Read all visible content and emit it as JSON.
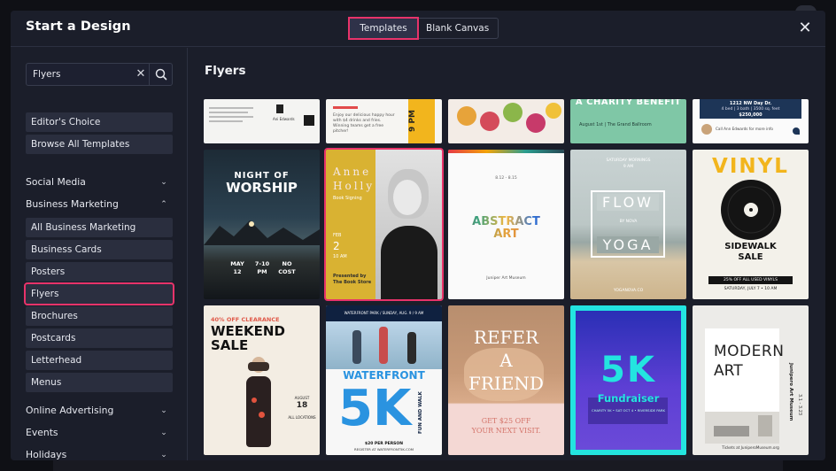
{
  "modal": {
    "title": "Start a Design",
    "tabs": [
      {
        "label": "Templates",
        "active": true
      },
      {
        "label": "Blank Canvas",
        "active": false
      }
    ],
    "close_icon": "close-icon"
  },
  "search": {
    "value": "Flyers",
    "clear_icon": "clear-x-icon",
    "search_icon": "search-icon"
  },
  "sidebar": {
    "top_items": [
      {
        "label": "Editor's Choice"
      },
      {
        "label": "Browse All Templates"
      }
    ],
    "sections": [
      {
        "label": "Social Media",
        "expanded": false
      },
      {
        "label": "Business Marketing",
        "expanded": true,
        "items": [
          {
            "label": "All Business Marketing"
          },
          {
            "label": "Business Cards"
          },
          {
            "label": "Posters"
          },
          {
            "label": "Flyers",
            "selected": true
          },
          {
            "label": "Brochures"
          },
          {
            "label": "Postcards"
          },
          {
            "label": "Letterhead"
          },
          {
            "label": "Menus"
          }
        ]
      },
      {
        "label": "Online Advertising",
        "expanded": false
      },
      {
        "label": "Events",
        "expanded": false
      },
      {
        "label": "Holidays",
        "expanded": false
      }
    ]
  },
  "main": {
    "title": "Flyers",
    "top_row": [
      {
        "name": "Ani Edwards",
        "text1": "Ani Edwards"
      },
      {
        "text1": "Enjoy our delicious happy hour with $4 drinks and fries. Winning teams get a free pitcher!",
        "text2": "9 PM"
      },
      {
        "text1": ""
      },
      {
        "text1": "A CHARITY BENEFIT",
        "text2": "August 1st | The Grand Ballroom"
      },
      {
        "text1": "1212 NW Day Dr.",
        "text2": "4 bed | 3 bath | 3500 sq. feet",
        "text3": "$250,000",
        "text4": "Call Ann Edwards for more info"
      }
    ],
    "row2": [
      {
        "title1": "NIGHT OF",
        "title2": "WORSHIP",
        "cols": [
          {
            "a": "MAY",
            "b": "12"
          },
          {
            "a": "7-10",
            "b": "PM"
          },
          {
            "a": "NO",
            "b": "COST"
          }
        ]
      },
      {
        "title1": "Anne",
        "title2": "Holly",
        "sub": "Book Signing",
        "date1": "FEB",
        "date2": "2",
        "date3": "10 AM",
        "foot": "Presented by The Book Store"
      },
      {
        "date": "8.12 - 8.15",
        "title1": "ABSTRACT",
        "title2": "ART",
        "foot": "Juniper Art Museum"
      },
      {
        "top": "SATURDAY MORNINGS",
        "top2": "9 AM",
        "title1": "FLOW",
        "by": "BY NOVA",
        "title2": "YOGA",
        "foot": "YOGANOVA.CO"
      },
      {
        "title1": "VINYL",
        "title2": "SIDEWALK",
        "title3": "SALE",
        "tag": "25% OFF ALL USED VINYLS",
        "foot": "SATURDAY, JULY 7 • 10 AM"
      }
    ],
    "row3": [
      {
        "top": "40% OFF CLEARANCE",
        "title1": "WEEKEND",
        "title2": "SALE",
        "side1": "AUGUST",
        "side2": "18",
        "side3": "ALL LOCATIONS"
      },
      {
        "top": "WATERFRONT PARK / SUNDAY, AUG. 9 / 9 AM",
        "title1": "WATERFRONT",
        "title2": "5K",
        "sub": "FUN AND WALK",
        "foot1": "$20 PER PERSON",
        "foot2": "REGISTER AT WATERFRONT5K.COM"
      },
      {
        "title1": "REFER",
        "title2": "A",
        "title3": "FRIEND",
        "sub1": "GET $25 OFF",
        "sub2": "YOUR NEXT VISIT."
      },
      {
        "title1": "5K",
        "title2": "Fundraiser",
        "foot": "CHARITY 5K • SAT OCT 4 • RIVERSIDE PARK"
      },
      {
        "title1": "MODERN",
        "title2": "ART",
        "side1": "Junipero Art Museum",
        "side2": "3.1 - 3.23",
        "foot": "Tickets at JuniperoMuseum.org"
      }
    ]
  },
  "colors": {
    "accent": "#e8336a",
    "modal_bg": "#1b1e2a",
    "sidebar_btn": "#2a2e3e"
  }
}
